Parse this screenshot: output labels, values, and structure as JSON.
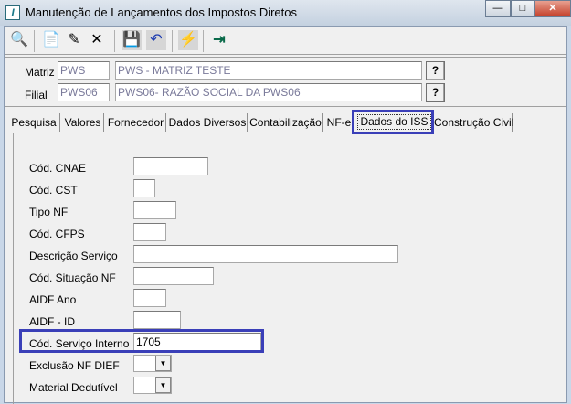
{
  "window": {
    "title": "Manutenção de Lançamentos dos Impostos Diretos",
    "app_icon": "I",
    "minimize": "—",
    "maximize": "□",
    "close": "✕"
  },
  "toolbar": {
    "items": [
      {
        "name": "search",
        "glyph": "🔍"
      },
      {
        "name": "new",
        "glyph": "📄"
      },
      {
        "name": "edit",
        "glyph": "✎"
      },
      {
        "name": "delete",
        "glyph": "✕"
      },
      {
        "name": "save",
        "glyph": "💾"
      },
      {
        "name": "undo",
        "glyph": "↶"
      },
      {
        "name": "filter",
        "glyph": "⚡"
      },
      {
        "name": "exit",
        "glyph": "⇥"
      }
    ]
  },
  "header": {
    "matriz_label": "Matriz",
    "matriz_code": "PWS",
    "matriz_name": "PWS - MATRIZ TESTE",
    "filial_label": "Filial",
    "filial_code": "PWS06",
    "filial_name": "PWS06- RAZÃO SOCIAL DA PWS06",
    "help": "?"
  },
  "tabs": [
    "Pesquisa",
    "Valores",
    "Fornecedor",
    "Dados Diversos",
    "Contabilização",
    "NF-e",
    "Dados do ISS",
    "Construção Civil"
  ],
  "active_tab": "Dados do ISS",
  "form": {
    "fields": [
      {
        "label": "Cód. CNAE",
        "value": ""
      },
      {
        "label": "Cód. CST",
        "value": ""
      },
      {
        "label": "Tipo NF",
        "value": ""
      },
      {
        "label": "Cód. CFPS",
        "value": ""
      },
      {
        "label": "Descrição Serviço",
        "value": ""
      },
      {
        "label": "Cód. Situação NF",
        "value": ""
      },
      {
        "label": "AIDF Ano",
        "value": ""
      },
      {
        "label": "AIDF - ID",
        "value": ""
      },
      {
        "label": "Cód. Serviço Interno",
        "value": "1705"
      },
      {
        "label": "Exclusão NF DIEF",
        "value": ""
      },
      {
        "label": "Material Dedutível",
        "value": ""
      }
    ],
    "dropdown_arrow": "▼"
  },
  "colors": {
    "highlight": "#3a3fb8"
  }
}
